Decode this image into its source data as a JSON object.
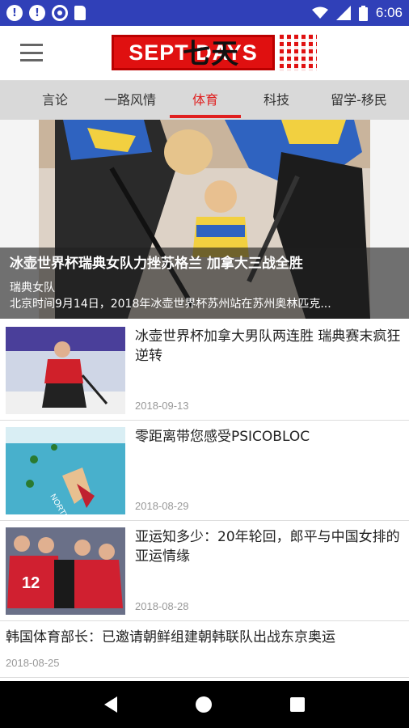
{
  "status_bar": {
    "time": "6:06"
  },
  "app_bar": {
    "logo_text": "SEPT DAYS",
    "logo_han": "七天"
  },
  "tabs": [
    {
      "label": "言论"
    },
    {
      "label": "一路风情"
    },
    {
      "label": "体育"
    },
    {
      "label": "科技"
    },
    {
      "label": "留学-移民"
    }
  ],
  "active_tab": "体育",
  "hero": {
    "title": "冰壶世界杯瑞典女队力挫苏格兰 加拿大三战全胜",
    "source": "瑞典女队",
    "summary": "北京时间9月14日，2018年冰壶世界杯苏州站在苏州奥林匹克..."
  },
  "articles": [
    {
      "title": "冰壶世界杯加拿大男队两连胜 瑞典赛末疯狂逆转",
      "date": "2018-09-13"
    },
    {
      "title": "零距离带您感受PSICOBLOC",
      "date": "2018-08-29"
    },
    {
      "title": "亚运知多少：20年轮回，郎平与中国女排的亚运情缘",
      "date": "2018-08-28"
    }
  ],
  "text_article": {
    "title": "韩国体育部长：已邀请朝鲜组建朝韩联队出战东京奥运",
    "date": "2018-08-25"
  },
  "colors": {
    "status_bar": "#3040b8",
    "accent": "#e02020",
    "tab_bar": "#d9d9d9"
  }
}
